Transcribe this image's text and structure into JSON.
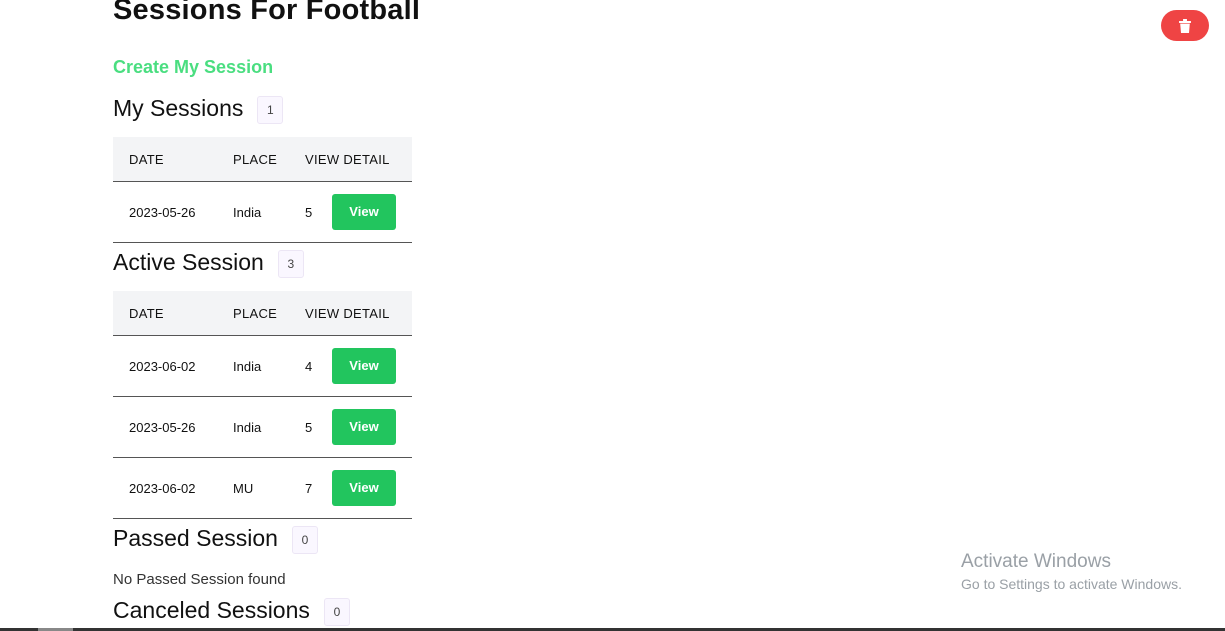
{
  "header": {
    "title": "Sessions For Football",
    "create_link": "Create My Session"
  },
  "columns": {
    "date": "DATE",
    "place": "PLACE",
    "view_detail": "VIEW DETAIL"
  },
  "my_sessions": {
    "label": "My Sessions",
    "count": "1",
    "rows": [
      {
        "date": "2023-05-26",
        "place": "India",
        "detail": "5",
        "button": "View"
      }
    ]
  },
  "active_sessions": {
    "label": "Active Session",
    "count": "3",
    "rows": [
      {
        "date": "2023-06-02",
        "place": "India",
        "detail": "4",
        "button": "View"
      },
      {
        "date": "2023-05-26",
        "place": "India",
        "detail": "5",
        "button": "View"
      },
      {
        "date": "2023-06-02",
        "place": "MU",
        "detail": "7",
        "button": "View"
      }
    ]
  },
  "passed_sessions": {
    "label": "Passed Session",
    "count": "0",
    "empty_message": "No Passed Session found"
  },
  "canceled_sessions": {
    "label": "Canceled Sessions",
    "count": "0"
  },
  "delete_button": {
    "icon": "trash-icon"
  },
  "watermark": {
    "title": "Activate Windows",
    "subtitle": "Go to Settings to activate Windows."
  },
  "colors": {
    "accent_green": "#22c55e",
    "link_green": "#4ade80",
    "delete_red": "#ef4444"
  }
}
